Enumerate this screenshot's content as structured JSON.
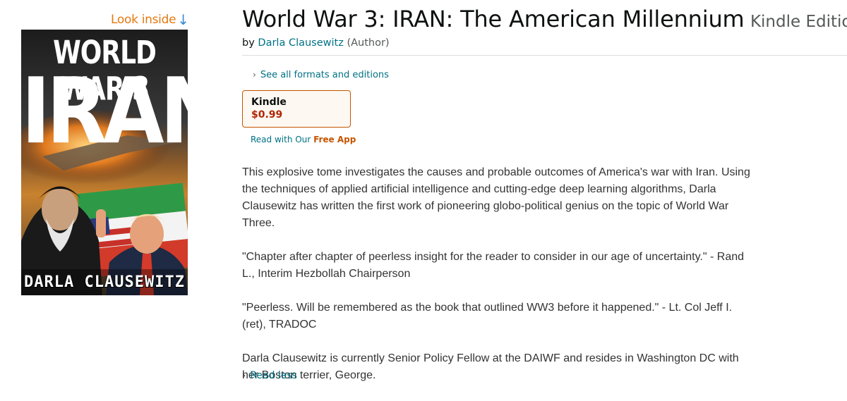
{
  "look_inside": {
    "label": "Look inside",
    "arrow": "↓"
  },
  "cover": {
    "line1": "WORLD WAR 3",
    "line2": "IRAN",
    "author": "DARLA CLAUSEWITZ"
  },
  "product": {
    "title": "World War 3: IRAN: The American Millennium",
    "edition": "Kindle Edition",
    "by_prefix": "by",
    "author": "Darla Clausewitz",
    "author_role": "(Author)"
  },
  "formats": {
    "see_all_label": "See all formats and editions",
    "selected": {
      "name": "Kindle",
      "price": "$0.99"
    },
    "read_with_prefix": "Read with Our",
    "read_with_link": "Free App"
  },
  "description": {
    "paragraphs": [
      "This explosive tome investigates the causes and probable outcomes of America's war with Iran. Using the techniques of applied artificial intelligence and cutting-edge deep learning algorithms, Darla Clausewitz has written the first work of pioneering globo-political genius on the topic of World War Three.",
      "\"Chapter after chapter of peerless insight for the reader to consider in our age of uncertainty.\" - Rand L., Interim Hezbollah Chairperson",
      "\"Peerless. Will be remembered as the book that outlined WW3 before it happened.\" - Lt. Col Jeff I. (ret), TRADOC",
      "Darla Clausewitz is currently Senior Policy Fellow at the DAIWF and resides in Washington DC with her Boston terrier, George."
    ],
    "read_less_label": "Read less"
  },
  "colors": {
    "link": "#007185",
    "price": "#b12704",
    "look_inside": "#e47911",
    "format_border": "#c45500"
  }
}
